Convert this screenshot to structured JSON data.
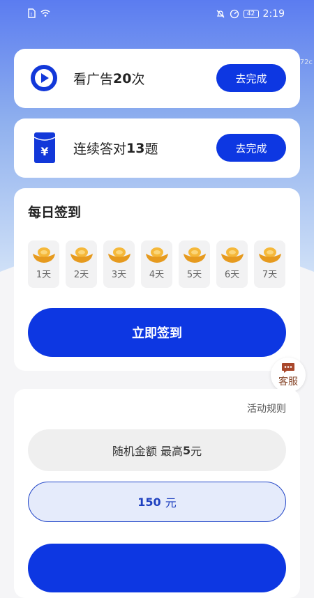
{
  "status_bar": {
    "time": "2:19",
    "battery": "42"
  },
  "watermark": "72c",
  "tasks": [
    {
      "prefix": "看广告",
      "count": "20",
      "suffix": "次",
      "button": "去完成",
      "icon": "play-icon"
    },
    {
      "prefix": "连续答对",
      "count": "13",
      "suffix": "题",
      "button": "去完成",
      "icon": "yen-card-icon"
    }
  ],
  "checkin": {
    "title": "每日签到",
    "days": [
      "1天",
      "2天",
      "3天",
      "4天",
      "5天",
      "6天",
      "7天"
    ],
    "button": "立即签到"
  },
  "service": {
    "label": "客服"
  },
  "withdraw": {
    "rules": "活动规则",
    "random_prefix": "随机金额 最高",
    "random_amount": "5",
    "random_unit": "元",
    "selected_amount": "150",
    "selected_unit": "元"
  },
  "colors": {
    "primary": "#0d37e2",
    "gradient_top": "#5b7cf0",
    "service_brown": "#8a4b2f"
  }
}
